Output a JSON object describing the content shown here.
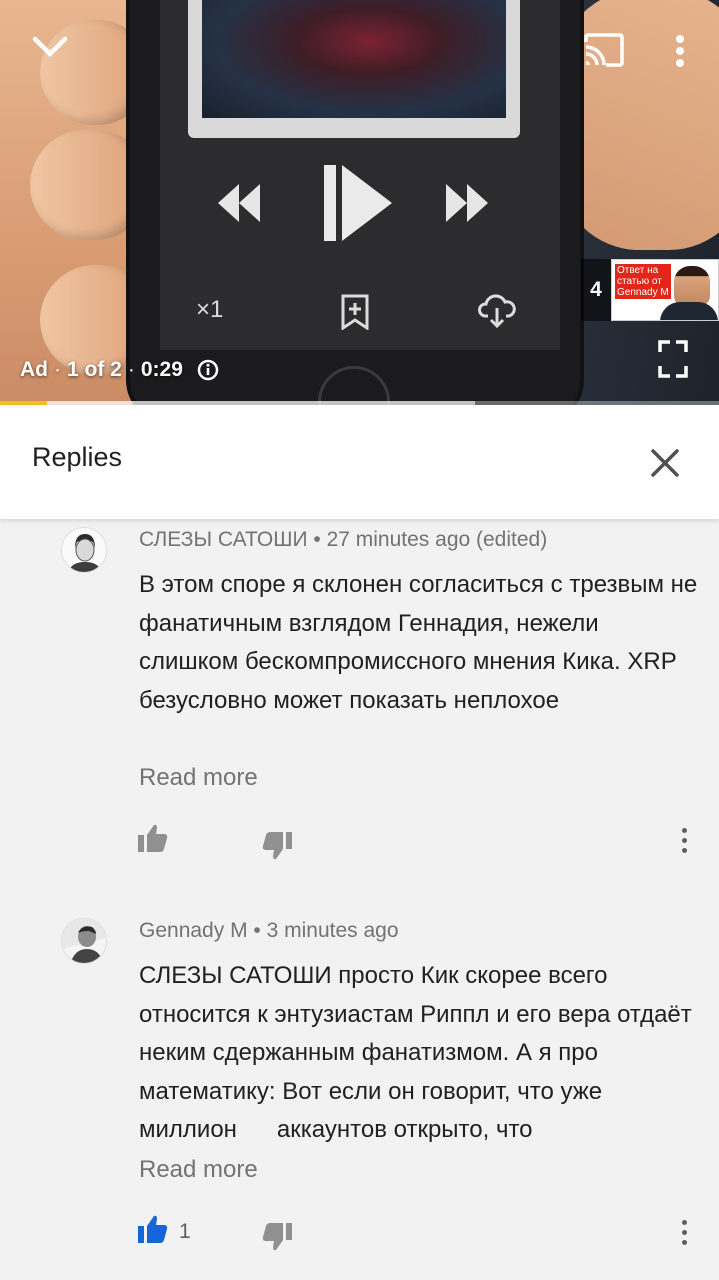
{
  "player": {
    "ad_label": "Ad",
    "ad_position": "1 of 2",
    "ad_time": "0:29",
    "speed_label": "×1",
    "up_next_count": "4",
    "up_next_thumb_title": "Ответ на статью от Gennady M",
    "progress_fraction": 0.066,
    "buffer_fraction": 0.66,
    "colors": {
      "progress": "#f0c21c"
    }
  },
  "replies": {
    "title": "Replies"
  },
  "comments": [
    {
      "author": "СЛЕЗЫ САТОШИ",
      "time": "27 minutes ago (edited)",
      "text": "В этом споре я склонен согласиться с трезвым не фанатичным взглядом Геннадия, нежели слишком бескомпромиссного мнения Кика. XRP безусловно может показать неплохое",
      "read_more": "Read more",
      "likes": "",
      "liked": false
    },
    {
      "author": "Gennady M",
      "time": "3 minutes ago",
      "text": "СЛЕЗЫ САТОШИ просто Кик скорее всего относится к энтузиастам Риппл и его вера отдаёт неким сдержанным фанатизмом. А я про математику: Вот если он говорит, что уже миллион      аккаунтов открыто, что",
      "read_more": "Read more",
      "likes": "1",
      "liked": true,
      "colors": {
        "liked_thumb": "#1565d8"
      }
    }
  ]
}
